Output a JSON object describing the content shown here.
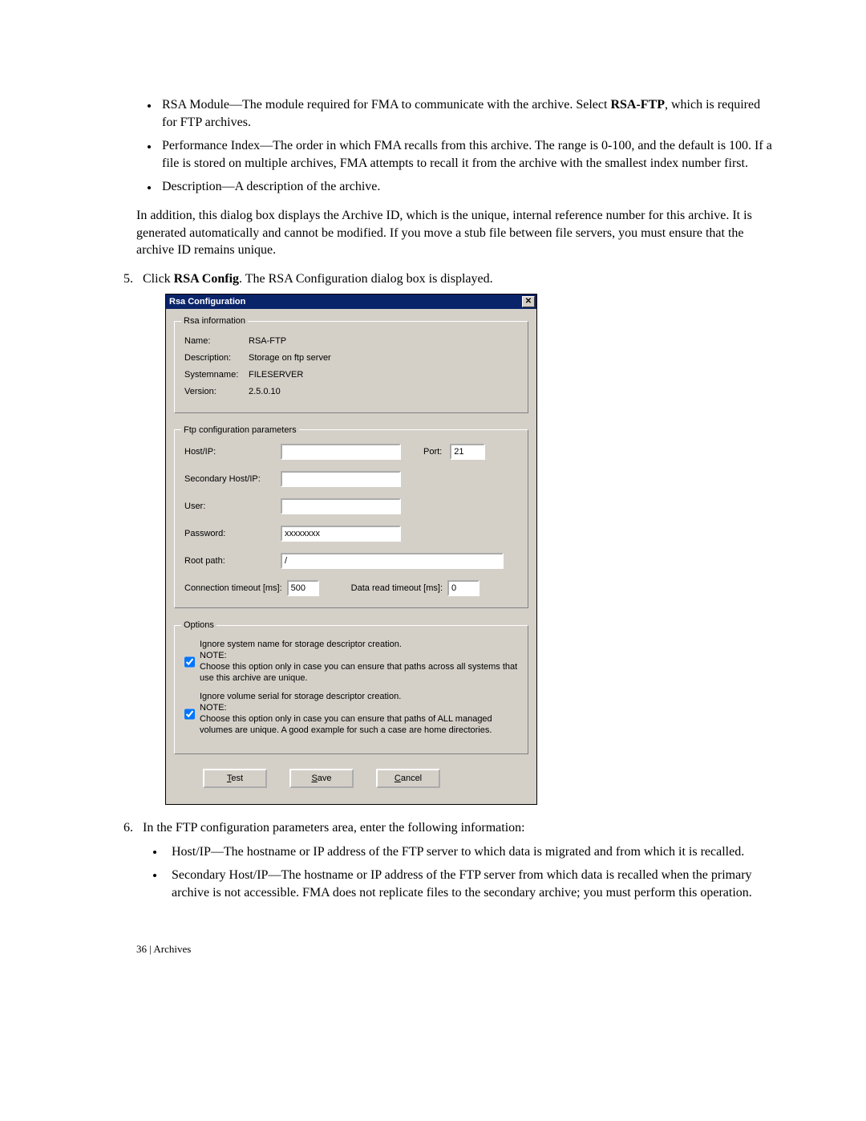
{
  "bullets_top": [
    {
      "term": "RSA Module",
      "text": "—The module required for FMA to communicate with the archive. Select ",
      "bold": "RSA-FTP",
      "tail": ", which is required for FTP archives."
    },
    {
      "term": "Performance Index",
      "text": "—The order in which FMA recalls from this archive. The range is 0-100, and the default is 100. If a file is stored on multiple archives, FMA attempts to recall it from the archive with the smallest index number first.",
      "bold": "",
      "tail": ""
    },
    {
      "term": "Description",
      "text": "—A description of the archive.",
      "bold": "",
      "tail": ""
    }
  ],
  "para_addition": "In addition, this dialog box displays the Archive ID, which is the unique, internal reference number for this archive. It is generated automatically and cannot be modified. If you move a stub file between file servers, you must ensure that the archive ID remains unique.",
  "step5_pre": "Click ",
  "step5_bold": "RSA Config",
  "step5_post": ". The RSA Configuration dialog box is displayed.",
  "dialog": {
    "title": "Rsa Configuration",
    "group_rsa": "Rsa information",
    "name_label": "Name:",
    "name_value": "RSA-FTP",
    "desc_label": "Description:",
    "desc_value": "Storage on ftp server",
    "sysname_label": "Systemname:",
    "sysname_value": "FILESERVER",
    "version_label": "Version:",
    "version_value": "2.5.0.10",
    "group_ftp": "Ftp configuration parameters",
    "hostip_label": "Host/IP:",
    "hostip_value": "",
    "port_label": "Port:",
    "port_value": "21",
    "sechost_label": "Secondary Host/IP:",
    "sechost_value": "",
    "user_label": "User:",
    "user_value": "",
    "pass_label": "Password:",
    "pass_value": "xxxxxxxx",
    "root_label": "Root path:",
    "root_value": "/",
    "conn_to_label": "Connection timeout [ms]:",
    "conn_to_value": "500",
    "data_to_label": "Data read timeout [ms]:",
    "data_to_value": "0",
    "group_options": "Options",
    "opt1_main": "Ignore system name for storage descriptor creation.",
    "opt1_note_lbl": "NOTE:",
    "opt1_note": "Choose this option only in case you can ensure that paths across all systems that use this archive are unique.",
    "opt2_main": "Ignore volume serial for storage descriptor creation.",
    "opt2_note_lbl": "NOTE:",
    "opt2_note": "Choose this option only in case you can ensure that paths of ALL managed volumes are unique. A good example for such a case are home directories.",
    "btn_test_u": "T",
    "btn_test": "est",
    "btn_save_u": "S",
    "btn_save": "ave",
    "btn_cancel_u": "C",
    "btn_cancel": "ancel"
  },
  "step6_text": "In the FTP configuration parameters area, enter the following information:",
  "bullets_bottom": [
    {
      "term": "Host/IP",
      "text": "—The hostname or IP address of the FTP server to which data is migrated and from which it is recalled."
    },
    {
      "term": "Secondary Host/IP",
      "text": "—The hostname or IP address of the FTP server from which data is recalled when the primary archive is not accessible. FMA does not replicate files to the secondary archive; you must perform this operation."
    }
  ],
  "footer": "36 | Archives"
}
